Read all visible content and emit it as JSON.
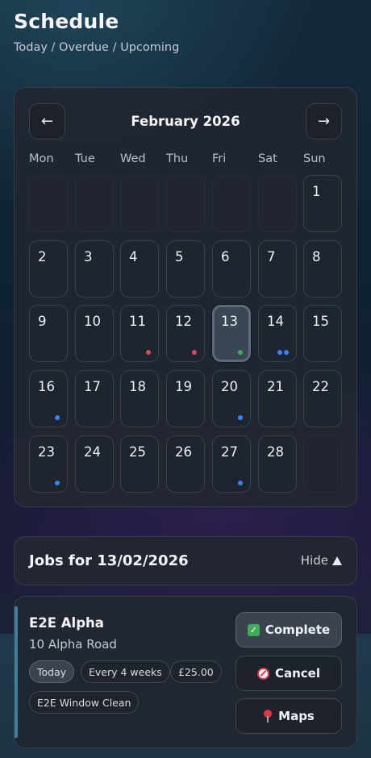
{
  "header": {
    "title": "Schedule",
    "subtitle": "Today / Overdue / Upcoming"
  },
  "calendar": {
    "month_title": "February 2026",
    "prev_icon": "arrow-left-icon",
    "next_icon": "arrow-right-icon",
    "prev_label": "←",
    "next_label": "→",
    "weekdays": [
      "Mon",
      "Tue",
      "Wed",
      "Thu",
      "Fri",
      "Sat",
      "Sun"
    ],
    "leading_empty": 6,
    "trailing_empty": 1,
    "selected_day": 13,
    "days": [
      "1",
      "2",
      "3",
      "4",
      "5",
      "6",
      "7",
      "8",
      "9",
      "10",
      "11",
      "12",
      "13",
      "14",
      "15",
      "16",
      "17",
      "18",
      "19",
      "20",
      "21",
      "22",
      "23",
      "24",
      "25",
      "26",
      "27",
      "28"
    ],
    "markers": {
      "11": [
        "#e0485a"
      ],
      "12": [
        "#e0485a"
      ],
      "13": [
        "#3fae5a"
      ],
      "14": [
        "#3b82f6",
        "#3b82f6"
      ],
      "16": [
        "#3b82f6"
      ],
      "20": [
        "#3b82f6"
      ],
      "23": [
        "#3b82f6"
      ],
      "27": [
        "#3b82f6"
      ]
    }
  },
  "jobs": {
    "title": "Jobs for 13/02/2026",
    "toggle_label": "Hide",
    "toggle_icon": "triangle-up-icon"
  },
  "job": {
    "client": "E2E Alpha",
    "address": "10 Alpha Road",
    "chips": {
      "today": "Today",
      "frequency": "Every 4 weeks",
      "price": "£25.00",
      "service": "E2E Window Clean"
    },
    "actions": {
      "complete": "Complete",
      "cancel": "Cancel",
      "maps": "Maps"
    },
    "accent_color": "#3e7fa0"
  },
  "colors": {
    "overdue": "#e0485a",
    "today": "#3fae5a",
    "upcoming": "#3b82f6"
  }
}
